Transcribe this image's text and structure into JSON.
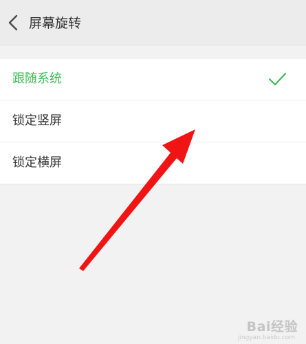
{
  "header": {
    "title": "屏幕旋转",
    "back_icon": "chevron-left-icon"
  },
  "options": [
    {
      "label": "跟随系统",
      "selected": true
    },
    {
      "label": "锁定竖屏",
      "selected": false
    },
    {
      "label": "锁定横屏",
      "selected": false
    }
  ],
  "check_icon": "checkmark-icon",
  "colors": {
    "accent": "#3fbb57",
    "annotation_arrow": "#f01414"
  },
  "watermark": {
    "brand": "Bai经验",
    "url": "jingyan.baidu.com"
  }
}
